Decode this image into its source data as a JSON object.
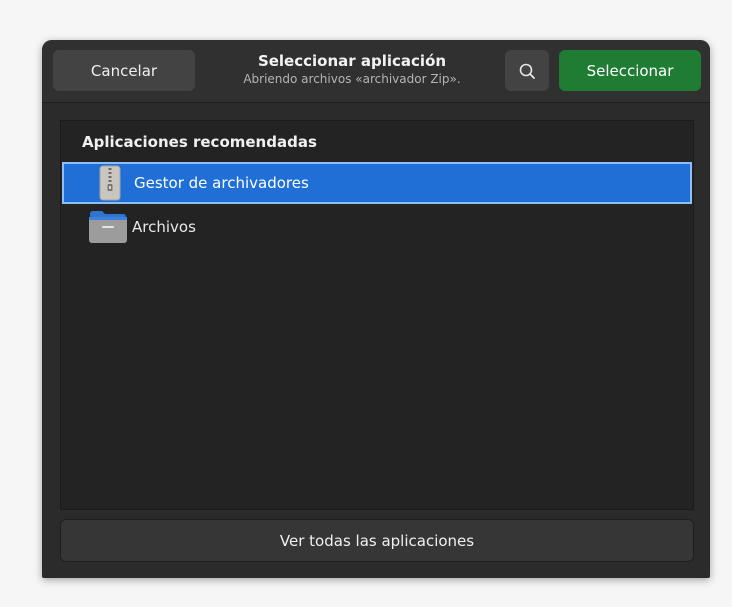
{
  "header": {
    "cancel_label": "Cancelar",
    "title": "Seleccionar aplicación",
    "subtitle": "Abriendo archivos «archivador Zip».",
    "search_icon": "search-icon",
    "select_label": "Seleccionar"
  },
  "list": {
    "heading": "Aplicaciones recomendadas",
    "items": [
      {
        "label": "Gestor de archivadores",
        "icon": "archive-manager-icon",
        "selected": true
      },
      {
        "label": "Archivos",
        "icon": "folder-icon",
        "selected": false
      }
    ]
  },
  "footer": {
    "show_all_label": "Ver todas las aplicaciones"
  },
  "colors": {
    "accent": "#1f6fd6",
    "suggested_action": "#1e7c33",
    "dialog_bg": "#2b2b2b"
  }
}
